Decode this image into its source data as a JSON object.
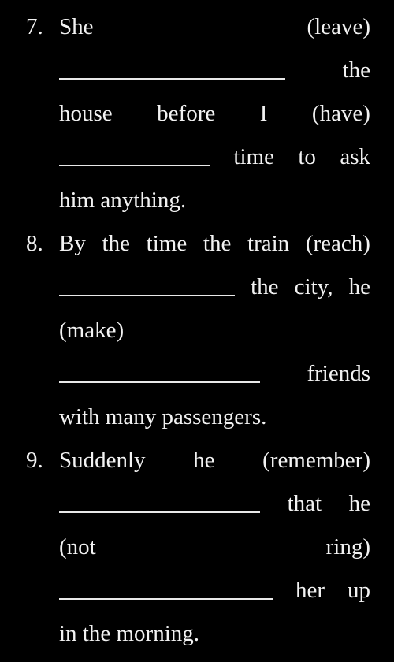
{
  "questions": [
    {
      "number": "7.",
      "lines": [
        {
          "words": [
            "She",
            "(leave)"
          ]
        },
        {
          "blank": true,
          "blank_chars": 19,
          "words": [
            "the"
          ]
        },
        {
          "words": [
            "house",
            "before",
            "I",
            "(have)"
          ]
        },
        {
          "blank": true,
          "blank_chars": 13,
          "words": [
            "time",
            "to",
            "ask"
          ]
        },
        {
          "words": [
            "him anything."
          ],
          "left": true
        }
      ]
    },
    {
      "number": "8.",
      "lines": [
        {
          "words": [
            "By",
            "the",
            "time",
            "the",
            "train",
            "(reach)"
          ]
        },
        {
          "blank": true,
          "blank_chars": 15,
          "words": [
            "the",
            "city,",
            "he"
          ]
        },
        {
          "words": [
            "(make)"
          ],
          "left": true
        },
        {
          "blank": true,
          "blank_chars": 17,
          "words": [
            "friends"
          ]
        },
        {
          "words": [
            "with many passengers."
          ],
          "left": true
        }
      ]
    },
    {
      "number": "9.",
      "lines": [
        {
          "words": [
            "Suddenly",
            "he",
            "(remember)"
          ]
        },
        {
          "blank": true,
          "blank_chars": 17,
          "words": [
            "that",
            "he"
          ]
        },
        {
          "words": [
            "(not",
            "ring)"
          ]
        },
        {
          "blank": true,
          "blank_chars": 18,
          "words": [
            "her",
            "up"
          ]
        },
        {
          "words": [
            "in the morning."
          ],
          "left": true
        }
      ]
    }
  ]
}
